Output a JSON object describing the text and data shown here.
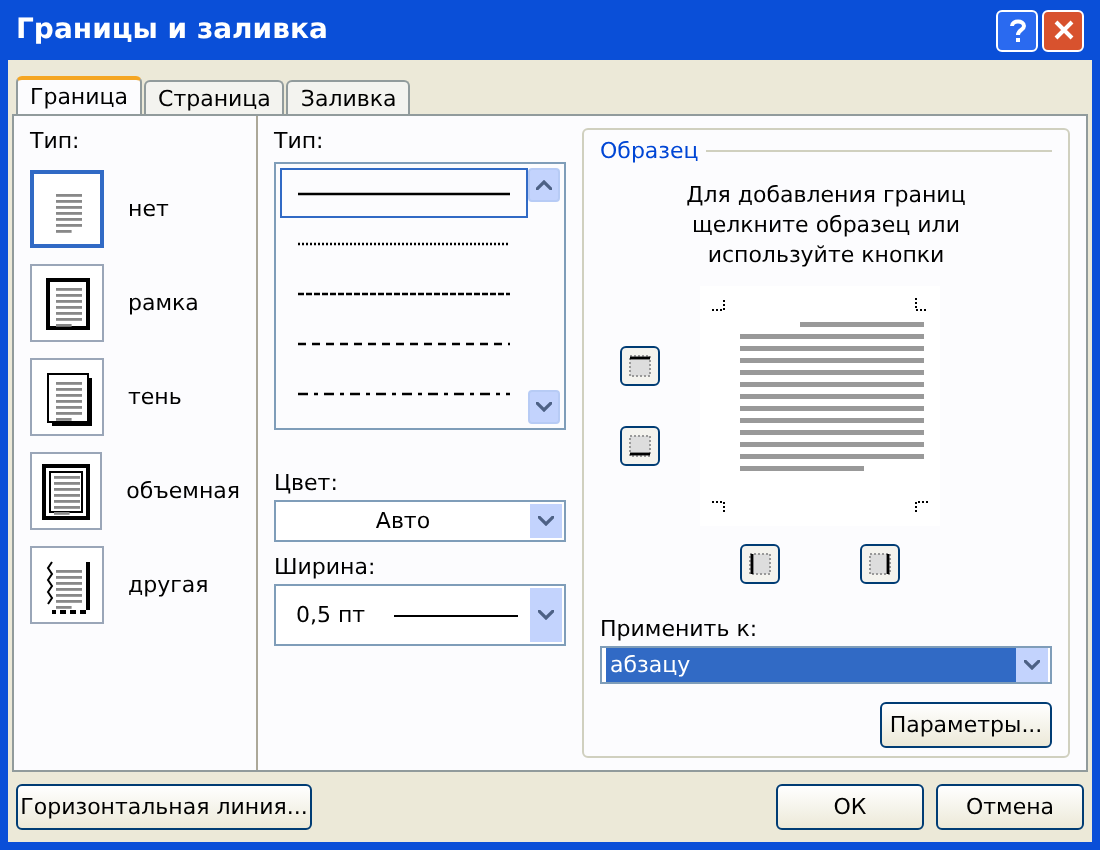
{
  "window": {
    "title": "Границы и заливка"
  },
  "tabs": [
    {
      "label": "Граница",
      "selected": true
    },
    {
      "label": "Страница",
      "selected": false
    },
    {
      "label": "Заливка",
      "selected": false
    }
  ],
  "setting": {
    "label": "Тип:",
    "items": [
      {
        "kind": "none",
        "label": "нет",
        "selected": true
      },
      {
        "kind": "box",
        "label": "рамка",
        "selected": false
      },
      {
        "kind": "shadow",
        "label": "тень",
        "selected": false
      },
      {
        "kind": "threed",
        "label": "объемная",
        "selected": false
      },
      {
        "kind": "custom",
        "label": "другая",
        "selected": false
      }
    ]
  },
  "style": {
    "label": "Тип:",
    "items": [
      {
        "kind": "solid",
        "selected": true
      },
      {
        "kind": "dotted",
        "selected": false
      },
      {
        "kind": "dashed",
        "selected": false
      },
      {
        "kind": "long-dash",
        "selected": false
      },
      {
        "kind": "dash-dot",
        "selected": false
      }
    ]
  },
  "color": {
    "label": "Цвет:",
    "value": "Авто"
  },
  "width": {
    "label": "Ширина:",
    "value": "0,5 пт"
  },
  "preview": {
    "title": "Образец",
    "hint": "Для добавления границ щелкните образец или используйте кнопки"
  },
  "apply_to": {
    "label": "Применить к:",
    "value": "абзацу"
  },
  "options_button": "Параметры...",
  "horizontal_line_button": "Горизонтальная линия...",
  "ok_button": "ОК",
  "cancel_button": "Отмена"
}
